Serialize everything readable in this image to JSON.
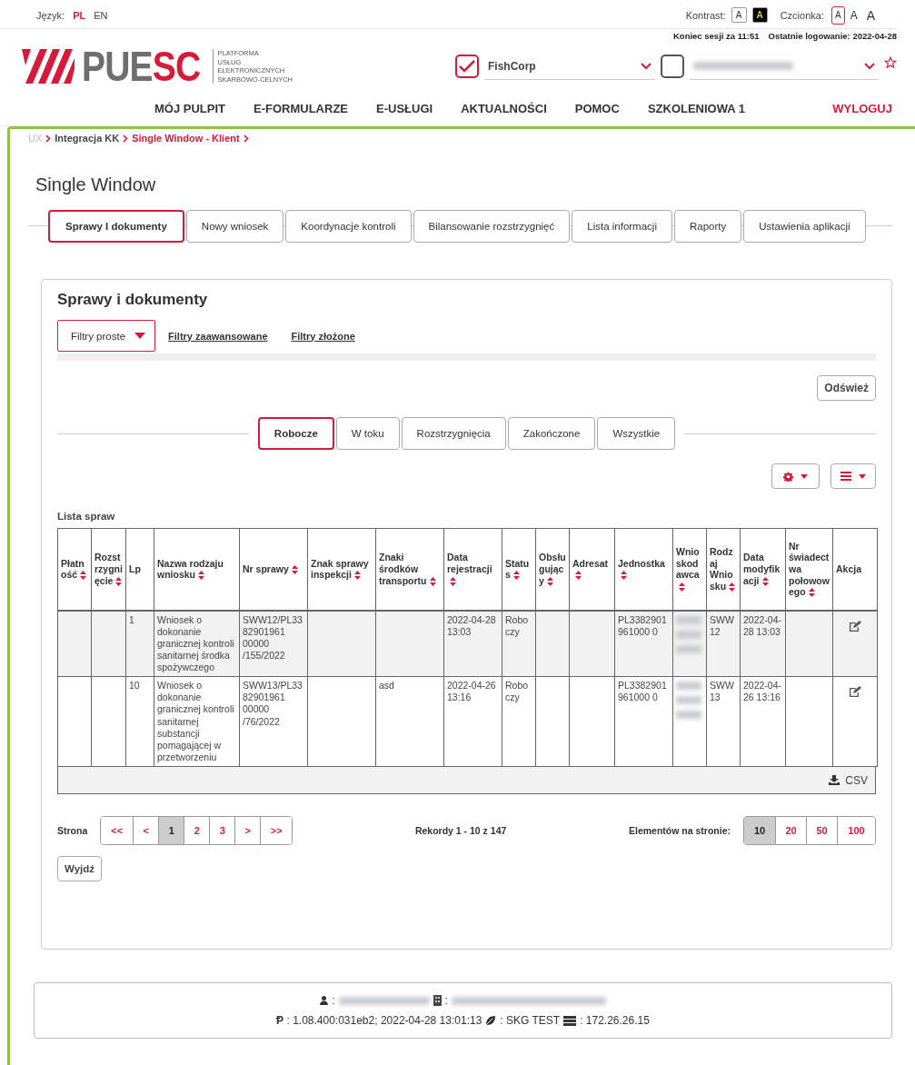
{
  "language": {
    "label": "Język:",
    "options": [
      {
        "label": "PL",
        "selected": true
      },
      {
        "label": "EN",
        "selected": false
      }
    ]
  },
  "contrast": {
    "label": "Kontrast:",
    "options": [
      {
        "label": "A",
        "kind": "light"
      },
      {
        "label": "A",
        "kind": "dark"
      }
    ]
  },
  "font_size": {
    "label": "Czcionka:",
    "options": [
      {
        "label": "A",
        "selected": true
      },
      {
        "label": "A",
        "selected": false
      },
      {
        "label": "A",
        "selected": false
      }
    ]
  },
  "session": {
    "timeout": "Koniec sesji za 11:51",
    "last_login": "Ostatnie logowanie: 2022-04-28"
  },
  "logo": {
    "primary": "PUE",
    "accent": "SC",
    "subtitle": [
      "PLATFORMA",
      "USŁUG",
      "ELEKTRONICZNYCH",
      "SKARBOWO-CELNYCH"
    ]
  },
  "context": [
    {
      "value": "FishCorp",
      "checked": true,
      "redacted": false
    },
    {
      "checked": false,
      "redacted": true
    }
  ],
  "nav": {
    "items": [
      {
        "label": "MÓJ PULPIT",
        "selected": false
      },
      {
        "label": "E-FORMULARZE",
        "selected": false
      },
      {
        "label": "E-USŁUGI",
        "selected": false
      },
      {
        "label": "AKTUALNOŚCI",
        "selected": false
      },
      {
        "label": "POMOC",
        "selected": false
      },
      {
        "label": "SZKOLENIOWA 1",
        "selected": false
      }
    ],
    "logout": "WYLOGUJ"
  },
  "breadcrumb": [
    {
      "label": "UX",
      "kind": "muted"
    },
    {
      "label": "Integracja KK",
      "kind": "link"
    },
    {
      "label": "Single Window - Klient",
      "kind": "current"
    }
  ],
  "page_title": "Single Window",
  "tabs": [
    {
      "label": "Sprawy I dokumenty",
      "selected": true
    },
    {
      "label": "Nowy wniosek",
      "selected": false
    },
    {
      "label": "Koordynacje kontroli",
      "selected": false
    },
    {
      "label": "Bilansowanie rozstrzygnięć",
      "selected": false
    },
    {
      "label": "Lista informacji",
      "selected": false
    },
    {
      "label": "Raporty",
      "selected": false
    },
    {
      "label": "Ustawienia aplikacji",
      "selected": false
    }
  ],
  "panel": {
    "title": "Sprawy i dokumenty",
    "filters": [
      {
        "label": "Filtry proste",
        "kind": "dropdown",
        "selected": true
      },
      {
        "label": "Filtry zaawansowane",
        "kind": "link",
        "selected": false
      },
      {
        "label": "Filtry złożone",
        "kind": "link",
        "selected": false
      }
    ],
    "refresh": "Odśwież",
    "status_tabs": [
      {
        "label": "Robocze",
        "selected": true
      },
      {
        "label": "W toku",
        "selected": false
      },
      {
        "label": "Rozstrzygnięcia",
        "selected": false
      },
      {
        "label": "Zakończone",
        "selected": false
      },
      {
        "label": "Wszystkie",
        "selected": false
      }
    ],
    "list_title": "Lista spraw",
    "table": {
      "columns": [
        {
          "label": "Płatność",
          "sortable": true,
          "kind": "text"
        },
        {
          "label": "Rozstrzygnięcie",
          "sortable": true,
          "kind": "text"
        },
        {
          "label": "Lp",
          "sortable": false,
          "kind": "text"
        },
        {
          "label": "Nazwa rodzaju wniosku",
          "sortable": true,
          "kind": "text"
        },
        {
          "label": "Nr sprawy",
          "sortable": true,
          "kind": "text"
        },
        {
          "label": "Znak sprawy inspekcji",
          "sortable": true,
          "kind": "text"
        },
        {
          "label": "Znaki środków transportu",
          "sortable": true,
          "kind": "text"
        },
        {
          "label": "Data rejestracji",
          "sortable": true,
          "kind": "text"
        },
        {
          "label": "Status",
          "sortable": true,
          "kind": "text"
        },
        {
          "label": "Obsługujący",
          "sortable": true,
          "kind": "text"
        },
        {
          "label": "Adresat",
          "sortable": true,
          "kind": "text"
        },
        {
          "label": "Jednostka",
          "sortable": true,
          "kind": "text"
        },
        {
          "label": "Wnioskodawca",
          "sortable": true,
          "kind": "redacted"
        },
        {
          "label": "Rodzaj Wniosku",
          "sortable": true,
          "kind": "text"
        },
        {
          "label": "Data modyfikacji",
          "sortable": true,
          "kind": "text"
        },
        {
          "label": "Nr świadectwa połowowego",
          "sortable": true,
          "kind": "text"
        },
        {
          "label": "Akcja",
          "sortable": false,
          "kind": "action"
        }
      ],
      "rows": [
        {
          "cells": [
            null,
            null,
            "1",
            "Wniosek o dokonanie granicznej kontroli sanitarnej środka spożywczego",
            "SWW12/PL3382901961 00000 /155/2022",
            null,
            null,
            "2022-04-28 13:03",
            "Roboczy",
            null,
            null,
            "PL3382901961000 0",
            null,
            "SWW 12",
            "2022-04-28 13:03",
            null,
            null
          ]
        },
        {
          "cells": [
            null,
            null,
            "10",
            "Wniosek o dokonanie granicznej kontroli sanitarnej substancji pomagającej w przetworzeniu",
            "SWW13/PL3382901961 00000 /76/2022",
            null,
            "asd",
            "2022-04-26 13:16",
            "Roboczy",
            null,
            null,
            "PL3382901961000 0",
            null,
            "SWW 13",
            "2022-04-26 13:16",
            null,
            null
          ]
        }
      ]
    },
    "export": "CSV",
    "pagination": {
      "label": "Strona",
      "pages": [
        {
          "label": "<<",
          "selected": false
        },
        {
          "label": "<",
          "selected": false
        },
        {
          "label": "1",
          "selected": true
        },
        {
          "label": "2",
          "selected": false
        },
        {
          "label": "3",
          "selected": false
        },
        {
          "label": ">",
          "selected": false
        },
        {
          "label": ">>",
          "selected": false
        }
      ],
      "records": "Rekordy 1 - 10 z 147",
      "per_page_label": "Elementów na stronie:",
      "per_page": [
        {
          "label": "10",
          "selected": true
        },
        {
          "label": "20",
          "selected": false
        },
        {
          "label": "50",
          "selected": false
        },
        {
          "label": "100",
          "selected": false
        }
      ]
    },
    "exit": "Wyjdź"
  },
  "footer": {
    "separator": ":",
    "environment": "SKG TEST",
    "version": "1.08.400:031eb2; 2022-04-28 13:01:13",
    "version_mark": "Ᵽ",
    "server": "172.26.26.15"
  }
}
